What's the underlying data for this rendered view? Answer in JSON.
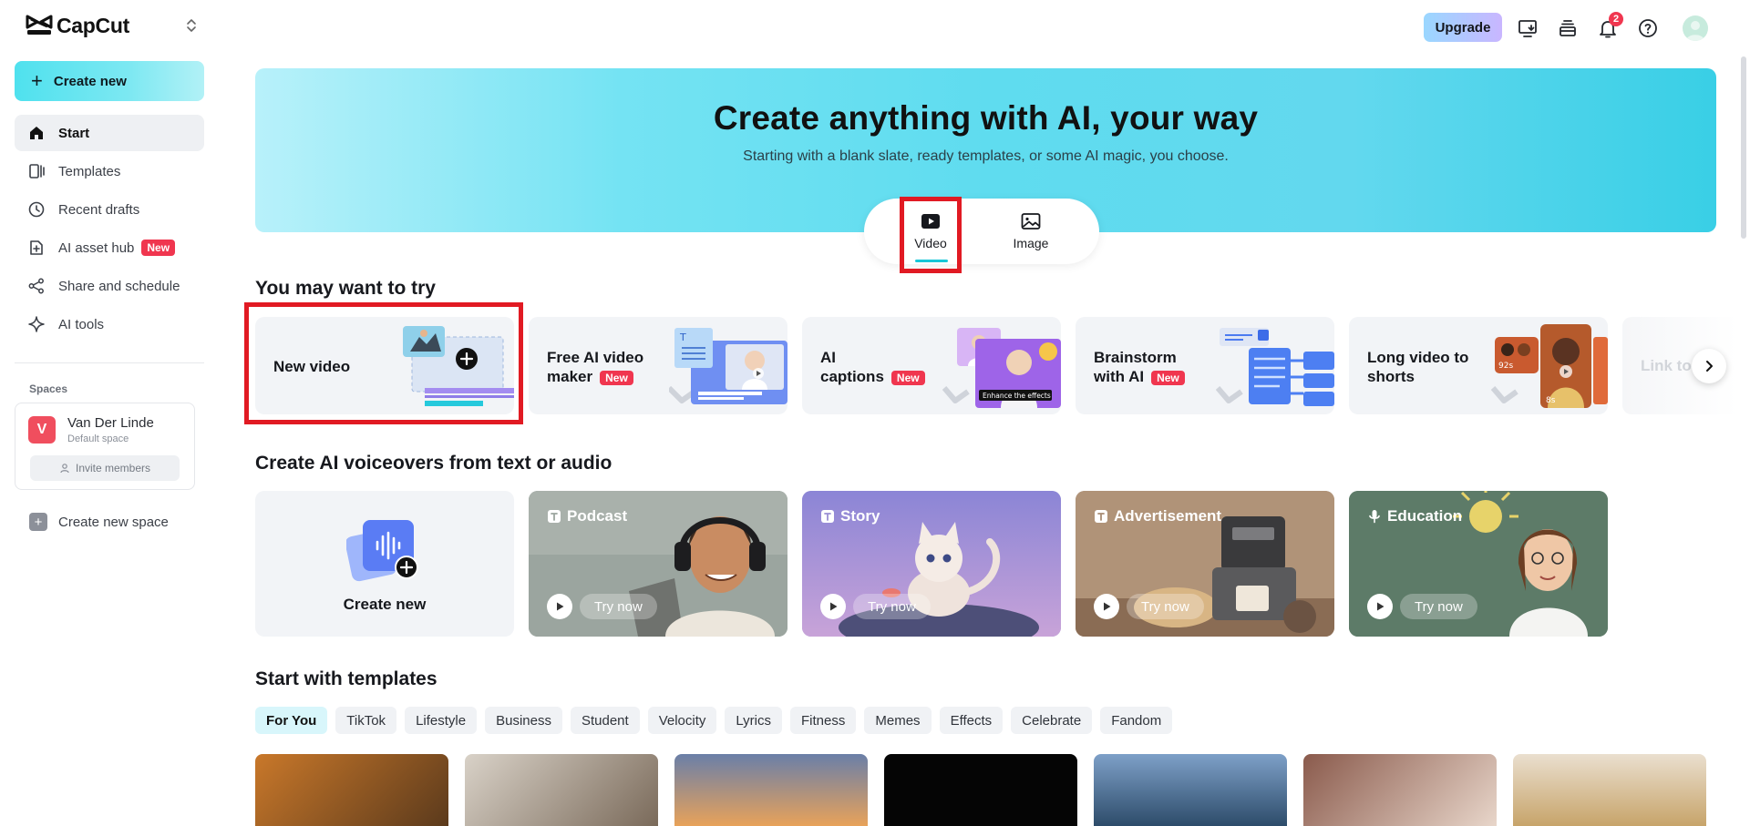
{
  "app": {
    "name": "CapCut"
  },
  "sidebar": {
    "create_label": "Create new",
    "items": [
      {
        "label": "Start",
        "icon": "home-icon"
      },
      {
        "label": "Templates",
        "icon": "templates-icon"
      },
      {
        "label": "Recent drafts",
        "icon": "clock-icon"
      },
      {
        "label": "AI asset hub",
        "icon": "asset-hub-icon",
        "badge": "New"
      },
      {
        "label": "Share and schedule",
        "icon": "share-icon"
      },
      {
        "label": "AI tools",
        "icon": "sparkle-icon"
      }
    ],
    "spaces_label": "Spaces",
    "space": {
      "initial": "V",
      "name": "Van Der Linde",
      "subtitle": "Default space",
      "invite_label": "Invite members"
    },
    "new_space_label": "Create new space"
  },
  "topbar": {
    "upgrade_label": "Upgrade",
    "notification_count": "2"
  },
  "hero": {
    "title": "Create anything with AI, your way",
    "subtitle": "Starting with a blank slate, ready templates, or some AI magic, you choose.",
    "modes": [
      {
        "label": "Video"
      },
      {
        "label": "Image"
      }
    ],
    "active_mode": "Video"
  },
  "try_section": {
    "title": "You may want to try",
    "cards": [
      {
        "label": "New video"
      },
      {
        "label_line1": "Free AI video",
        "label_line2": "maker",
        "badge": "New"
      },
      {
        "label_line1": "AI",
        "label_line2": "captions",
        "badge": "New"
      },
      {
        "label_line1": "Brainstorm",
        "label_line2": "with AI",
        "badge": "New"
      },
      {
        "label_line1": "Long video to",
        "label_line2": "shorts"
      }
    ],
    "partial_card_label": "Link to",
    "captions_art_text": "Enhance the effects",
    "shorts_art_labels": [
      "92s",
      "8s"
    ]
  },
  "voiceover_section": {
    "title": "Create AI voiceovers from text or audio",
    "create_label": "Create new",
    "cards": [
      {
        "label": "Podcast",
        "action": "Try now"
      },
      {
        "label": "Story",
        "action": "Try now"
      },
      {
        "label": "Advertisement",
        "action": "Try now"
      },
      {
        "label": "Education",
        "action": "Try now"
      }
    ]
  },
  "templates_section": {
    "title": "Start with templates",
    "chips": [
      "For You",
      "TikTok",
      "Lifestyle",
      "Business",
      "Student",
      "Velocity",
      "Lyrics",
      "Fitness",
      "Memes",
      "Effects",
      "Celebrate",
      "Fandom"
    ],
    "active_chip": "For You"
  },
  "colors": {
    "accent": "#17c7d8",
    "highlight_box": "#e11a23",
    "badge": "#f0364f"
  }
}
